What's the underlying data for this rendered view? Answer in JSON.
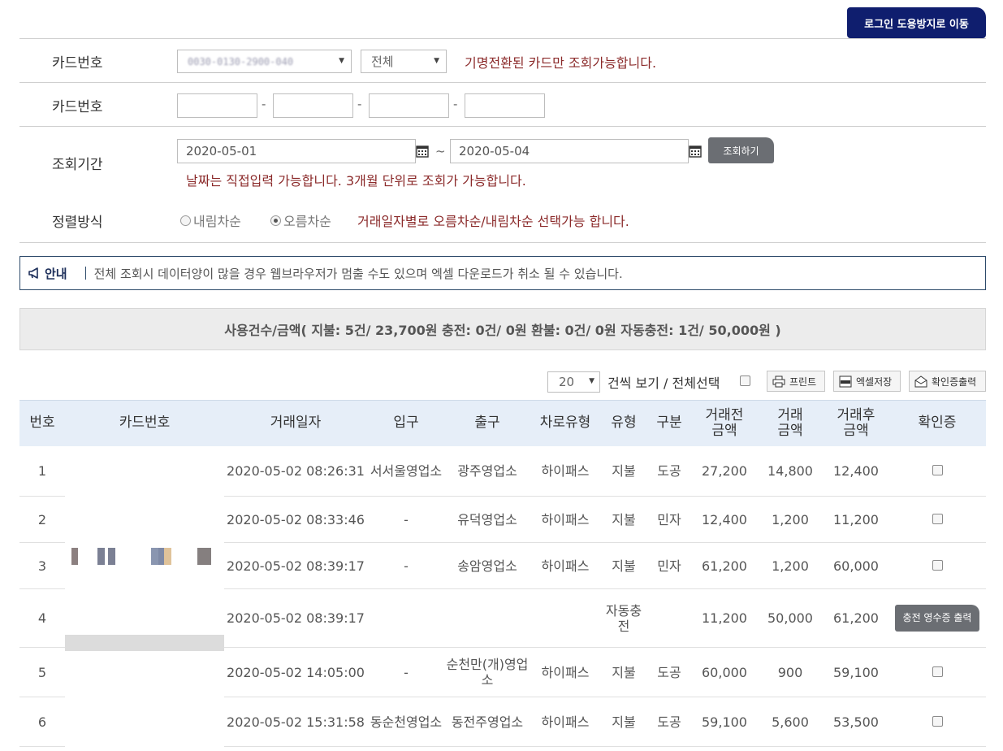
{
  "header": {
    "login_button": "로그인 도용방지로 이동"
  },
  "form": {
    "card_label_1": "카드번호",
    "card_select_value": "0030-0130-2900-040",
    "type_select_value": "전체",
    "card_note": "기명전환된 카드만 조회가능합니다.",
    "card_label_2": "카드번호",
    "card_inputs": [
      "",
      "",
      "",
      ""
    ],
    "period_label": "조회기간",
    "date_from": "2020-05-01",
    "date_tilde": "~",
    "date_to": "2020-05-04",
    "search_button": "조회하기",
    "date_note": "날짜는 직접입력 가능합니다. 3개월 단위로 조회가 가능합니다.",
    "sort_label": "정렬방식",
    "sort_desc": "내림차순",
    "sort_asc": "오름차순",
    "sort_selected": "오름차순",
    "sort_note": "거래일자별로 오름차순/내림차순 선택가능 합니다."
  },
  "notice": {
    "title": "안내",
    "text": "전체 조회시 데이터양이 많을 경우 웹브라우저가 멈출 수도 있으며 엑셀 다운로드가 취소 될 수 있습니다."
  },
  "summary": {
    "text": "사용건수/금액( 지불: 5건/ 23,700원 충전: 0건/ 0원 환불: 0건/ 0원 자동충전: 1건/ 50,000원 )"
  },
  "toolbar": {
    "page_size": "20",
    "page_size_text": "건씩 보기 / 전체선택",
    "print": "프린트",
    "excel": "엑셀저장",
    "certificate": "확인증출력"
  },
  "table": {
    "headers": [
      "번호",
      "카드번호",
      "거래일자",
      "입구",
      "출구",
      "차로유형",
      "유형",
      "구분",
      "거래전\n금액",
      "거래\n금액",
      "거래후\n금액",
      "확인증"
    ],
    "rows": [
      {
        "no": "1",
        "date": "2020-05-02 08:26:31",
        "entry": "서서울영업소",
        "exit": "광주영업소",
        "lane": "하이패스",
        "type": "지불",
        "class": "도공",
        "before": "27,200",
        "amount": "14,800",
        "after": "12,400",
        "cert": "checkbox"
      },
      {
        "no": "2",
        "date": "2020-05-02 08:33:46",
        "entry": "-",
        "exit": "유덕영업소",
        "lane": "하이패스",
        "type": "지불",
        "class": "민자",
        "before": "12,400",
        "amount": "1,200",
        "after": "11,200",
        "cert": "checkbox"
      },
      {
        "no": "3",
        "date": "2020-05-02 08:39:17",
        "entry": "-",
        "exit": "송암영업소",
        "lane": "하이패스",
        "type": "지불",
        "class": "민자",
        "before": "61,200",
        "amount": "1,200",
        "after": "60,000",
        "cert": "checkbox"
      },
      {
        "no": "4",
        "date": "2020-05-02 08:39:17",
        "entry": "",
        "exit": "",
        "lane": "",
        "type": "자동충전",
        "class": "",
        "before": "11,200",
        "amount": "50,000",
        "after": "61,200",
        "cert": "충전 영수증 출력"
      },
      {
        "no": "5",
        "date": "2020-05-02 14:05:00",
        "entry": "-",
        "exit": "순천만(개)영업소",
        "lane": "하이패스",
        "type": "지불",
        "class": "도공",
        "before": "60,000",
        "amount": "900",
        "after": "59,100",
        "cert": "checkbox"
      },
      {
        "no": "6",
        "date": "2020-05-02 15:31:58",
        "entry": "동순천영업소",
        "exit": "동전주영업소",
        "lane": "하이패스",
        "type": "지불",
        "class": "도공",
        "before": "59,100",
        "amount": "5,600",
        "after": "53,500",
        "cert": "checkbox"
      }
    ]
  }
}
